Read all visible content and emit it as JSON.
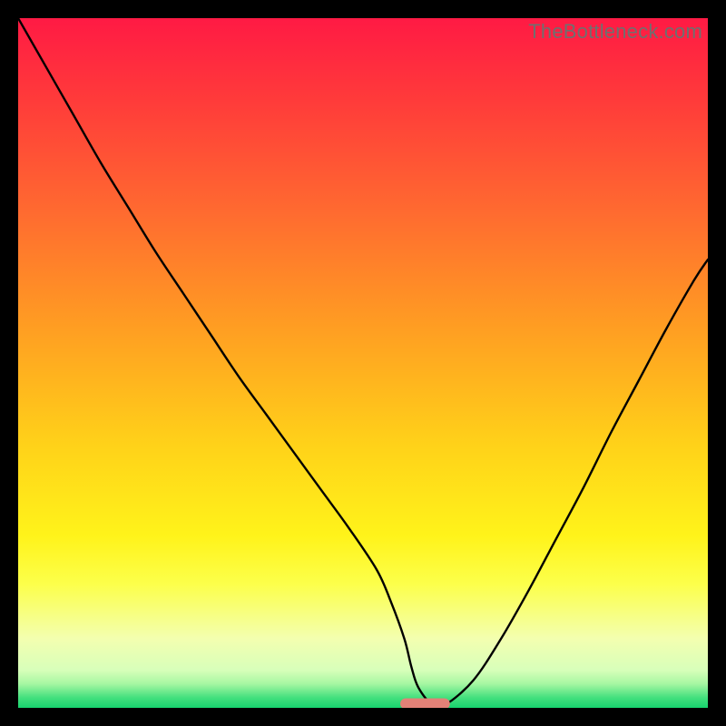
{
  "watermark": "TheBottleneck.com",
  "colors": {
    "black": "#000000",
    "curve": "#000000",
    "marker": "#e38177",
    "gradient_stops": [
      {
        "offset": 0.0,
        "color": "#ff1a44"
      },
      {
        "offset": 0.12,
        "color": "#ff3b3a"
      },
      {
        "offset": 0.28,
        "color": "#ff6a30"
      },
      {
        "offset": 0.45,
        "color": "#ff9e22"
      },
      {
        "offset": 0.62,
        "color": "#ffd219"
      },
      {
        "offset": 0.75,
        "color": "#fff31a"
      },
      {
        "offset": 0.82,
        "color": "#fcff4a"
      },
      {
        "offset": 0.9,
        "color": "#f3ffb0"
      },
      {
        "offset": 0.945,
        "color": "#d8ffba"
      },
      {
        "offset": 0.965,
        "color": "#a7f7a2"
      },
      {
        "offset": 0.985,
        "color": "#44e07e"
      },
      {
        "offset": 1.0,
        "color": "#17d36e"
      }
    ]
  },
  "chart_data": {
    "type": "line",
    "title": "",
    "xlabel": "",
    "ylabel": "",
    "xlim": [
      0,
      100
    ],
    "ylim": [
      0,
      100
    ],
    "x": [
      0,
      4,
      8,
      12,
      16,
      20,
      24,
      28,
      32,
      36,
      40,
      44,
      48,
      52,
      54,
      56,
      57,
      58,
      60,
      62,
      66,
      70,
      74,
      78,
      82,
      86,
      90,
      94,
      98,
      100
    ],
    "values": [
      100,
      93,
      86,
      79,
      72.5,
      66,
      60,
      54,
      48,
      42.5,
      37,
      31.5,
      26,
      20,
      15.5,
      10,
      6,
      3,
      0.5,
      0.5,
      4,
      10,
      17,
      24.5,
      32,
      40,
      47.5,
      55,
      62,
      65
    ],
    "optimum_marker": {
      "x_center": 59,
      "x_half_width": 3.6,
      "y": 0.6
    },
    "series": [
      {
        "name": "bottleneck-curve",
        "x_key": "x",
        "y_key": "values"
      }
    ]
  }
}
